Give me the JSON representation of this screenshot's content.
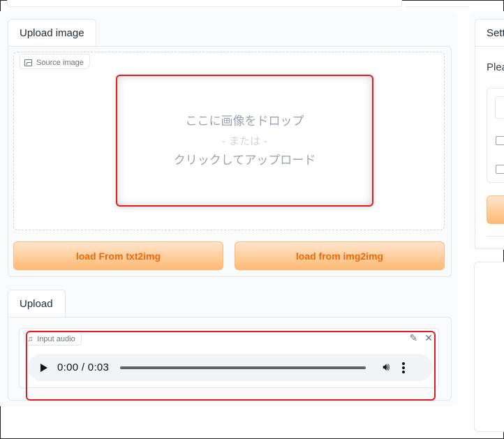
{
  "image_panel": {
    "tab_label": "Upload image",
    "source_label": "Source image",
    "drop_line1": "ここに画像をドロップ",
    "drop_line2": "- または -",
    "drop_line3": "クリックしてアップロード",
    "btn_txt2img": "load From txt2img",
    "btn_img2img": "load from img2img"
  },
  "audio_panel": {
    "tab_label": "Upload",
    "input_label": "Input audio",
    "time_display": "0:00 / 0:03"
  },
  "right_panel": {
    "tab_label": "Sett",
    "text_fragment": "Plea"
  },
  "colors": {
    "accent_orange": "#fdba74",
    "button_text": "#ea6a0a",
    "highlight_red": "#e11d23"
  },
  "icons": {
    "source_icon": "image-icon",
    "audio_icon": "music-note-icon",
    "edit": "pencil-icon",
    "close": "close-icon",
    "play": "play-icon",
    "volume": "volume-icon",
    "more": "more-vertical-icon"
  }
}
